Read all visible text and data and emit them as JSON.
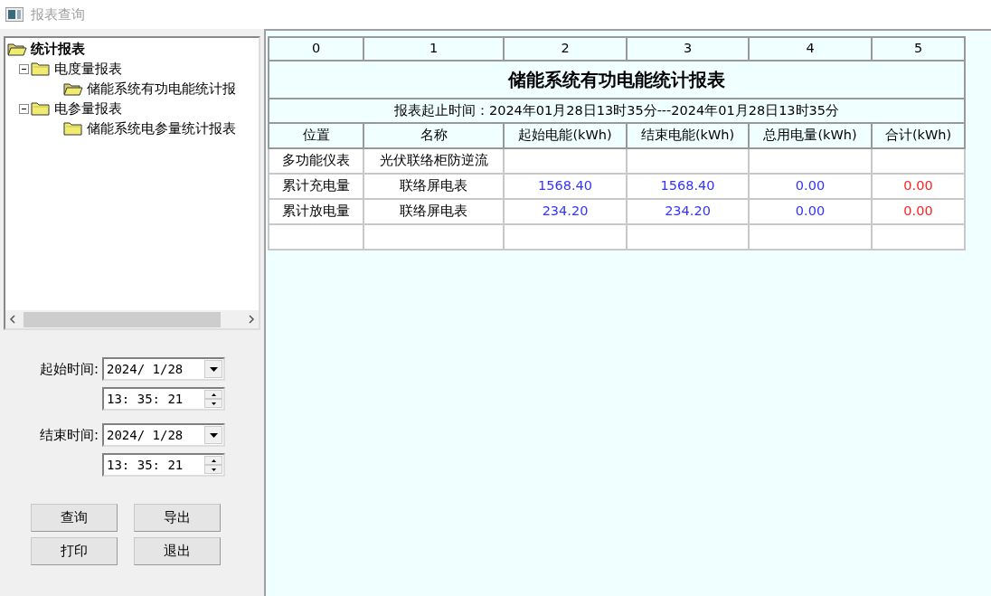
{
  "window": {
    "title": "报表查询"
  },
  "tree": {
    "label": "统计报表",
    "children": [
      {
        "label": "电度量报表",
        "expanded": true,
        "children": [
          {
            "label": "储能系统有功电能统计报",
            "selected": true
          }
        ]
      },
      {
        "label": "电参量报表",
        "expanded": true,
        "children": [
          {
            "label": "储能系统电参量统计报表",
            "selected": false
          }
        ]
      }
    ]
  },
  "start_time": {
    "label": "起始时间:",
    "date": "2024/ 1/28",
    "time": "13: 35: 21"
  },
  "end_time": {
    "label": "结束时间:",
    "date": "2024/ 1/28",
    "time": "13: 35: 21"
  },
  "buttons": [
    "查询",
    "导出",
    "打印",
    "退出"
  ],
  "grid": {
    "column_numbers": [
      "0",
      "1",
      "2",
      "3",
      "4",
      "5"
    ],
    "report_title": "储能系统有功电能统计报表",
    "report_period": "报表起止时间：2024年01月28日13时35分---2024年01月28日13时35分",
    "columns": [
      "位置",
      "名称",
      "起始电能(kWh)",
      "结束电能(kWh)",
      "总用电量(kWh)",
      "合计(kWh)"
    ],
    "rows": [
      [
        {
          "text": "多功能仪表"
        },
        {
          "text": "光伏联络柜防逆流"
        },
        {
          "text": ""
        },
        {
          "text": ""
        },
        {
          "text": ""
        },
        {
          "text": ""
        }
      ],
      [
        {
          "text": "累计充电量"
        },
        {
          "text": "联络屏电表"
        },
        {
          "text": "1568.40",
          "color": "#3333ff"
        },
        {
          "text": "1568.40",
          "color": "#3333ff"
        },
        {
          "text": "0.00",
          "color": "#3333ff"
        },
        {
          "text": "0.00",
          "color": "#ff2222"
        }
      ],
      [
        {
          "text": "累计放电量"
        },
        {
          "text": "联络屏电表"
        },
        {
          "text": "234.20",
          "color": "#3333ff"
        },
        {
          "text": "234.20",
          "color": "#3333ff"
        },
        {
          "text": "0.00",
          "color": "#3333ff"
        },
        {
          "text": "0.00",
          "color": "#ff2222"
        }
      ],
      [
        {
          "text": ""
        },
        {
          "text": ""
        },
        {
          "text": ""
        },
        {
          "text": ""
        },
        {
          "text": ""
        },
        {
          "text": ""
        }
      ]
    ]
  }
}
